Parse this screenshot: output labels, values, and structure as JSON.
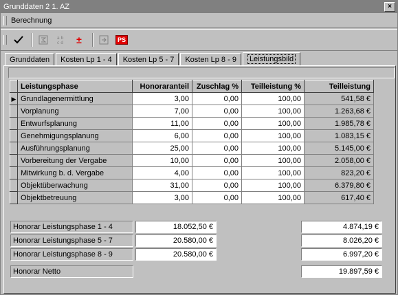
{
  "window": {
    "title": "Grunddaten 2 1. AZ",
    "close_glyph": "×"
  },
  "menu": {
    "items": [
      "Berechnung"
    ]
  },
  "toolbar": {
    "buttons": [
      {
        "icon": "checkmark-icon"
      },
      {
        "icon": "calc-disabled-icon"
      },
      {
        "icon": "edit-disabled-icon"
      },
      {
        "icon": "plus-minus-icon",
        "glyph": "±",
        "color": "#e00000"
      },
      {
        "icon": "export-disabled-icon"
      },
      {
        "icon": "ps-icon",
        "glyph": "PS",
        "color": "#e00000"
      }
    ]
  },
  "tabs": [
    "Grunddaten",
    "Kosten Lp 1 - 4",
    "Kosten Lp 5 - 7",
    "Kosten Lp 8 - 9",
    "Leistungsbild"
  ],
  "table": {
    "headers": [
      "Leistungsphase",
      "Honoraranteil",
      "Zuschlag %",
      "Teilleistung %",
      "Teilleistung"
    ],
    "rows": [
      [
        "Grundlagenermittlung",
        "3,00",
        "0,00",
        "100,00",
        "541,58 €"
      ],
      [
        "Vorplanung",
        "7,00",
        "0,00",
        "100,00",
        "1.263,68 €"
      ],
      [
        "Entwurfsplanung",
        "11,00",
        "0,00",
        "100,00",
        "1.985,78 €"
      ],
      [
        "Genehmigungsplanung",
        "6,00",
        "0,00",
        "100,00",
        "1.083,15 €"
      ],
      [
        "Ausführungsplanung",
        "25,00",
        "0,00",
        "100,00",
        "5.145,00 €"
      ],
      [
        "Vorbereitung der Vergabe",
        "10,00",
        "0,00",
        "100,00",
        "2.058,00 €"
      ],
      [
        "Mitwirkung b. d. Vergabe",
        "4,00",
        "0,00",
        "100,00",
        "823,20 €"
      ],
      [
        "Objektüberwachung",
        "31,00",
        "0,00",
        "100,00",
        "6.379,80 €"
      ],
      [
        "Objektbetreuung",
        "3,00",
        "0,00",
        "100,00",
        "617,40 €"
      ]
    ]
  },
  "summary": {
    "lp14": {
      "label": "Honorar Leistungsphase 1 - 4",
      "basis": "18.052,50 €",
      "value": "4.874,19 €"
    },
    "lp57": {
      "label": "Honorar Leistungsphase 5 - 7",
      "basis": "20.580,00 €",
      "value": "8.026,20 €"
    },
    "lp89": {
      "label": "Honorar Leistungsphase 8 - 9",
      "basis": "20.580,00 €",
      "value": "6.997,20 €"
    },
    "netto": {
      "label": "Honorar Netto",
      "value": "19.897,59 €"
    }
  }
}
